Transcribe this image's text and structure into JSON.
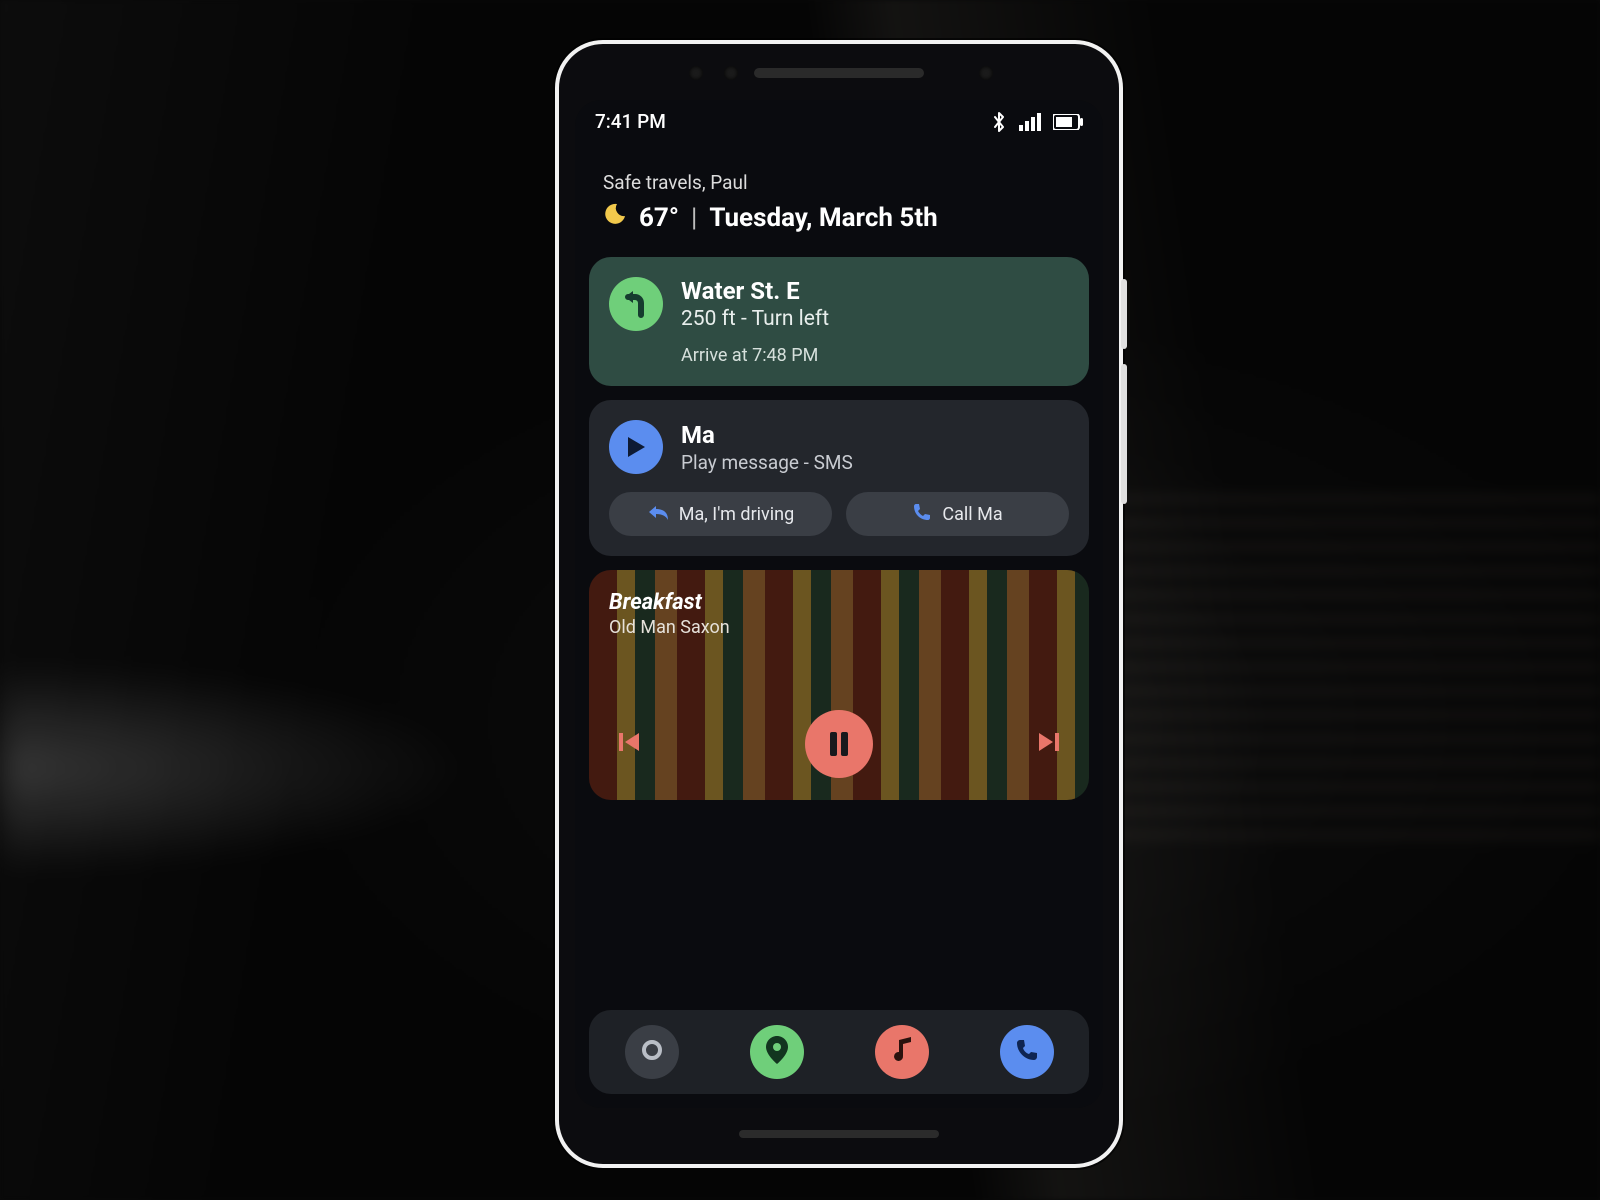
{
  "statusbar": {
    "time": "7:41 PM",
    "icons": [
      "bluetooth",
      "cellular",
      "battery"
    ]
  },
  "header": {
    "greeting": "Safe travels, Paul",
    "weather_icon": "moon",
    "temperature": "67°",
    "separator": "|",
    "date": "Tuesday, March 5th"
  },
  "navigation": {
    "icon": "turn-left",
    "street": "Water St. E",
    "instruction": "250 ft - Turn left",
    "arrival": "Arrive at 7:48 PM"
  },
  "message": {
    "sender": "Ma",
    "subtitle": "Play message - SMS",
    "reply_action": {
      "icon": "reply",
      "label": "Ma, I'm driving"
    },
    "call_action": {
      "icon": "phone",
      "label": "Call Ma"
    }
  },
  "music": {
    "title": "Breakfast",
    "artist": "Old Man Saxon",
    "state": "playing",
    "controls": [
      "previous",
      "pause",
      "next"
    ]
  },
  "bottombar": {
    "items": [
      "home",
      "map-marker",
      "music-note",
      "phone"
    ]
  },
  "colors": {
    "accent_green": "#6fcf7a",
    "accent_blue": "#5b8def",
    "accent_coral": "#e9766a",
    "nav_card_bg": "#2f4c43",
    "card_bg": "#23262c"
  }
}
